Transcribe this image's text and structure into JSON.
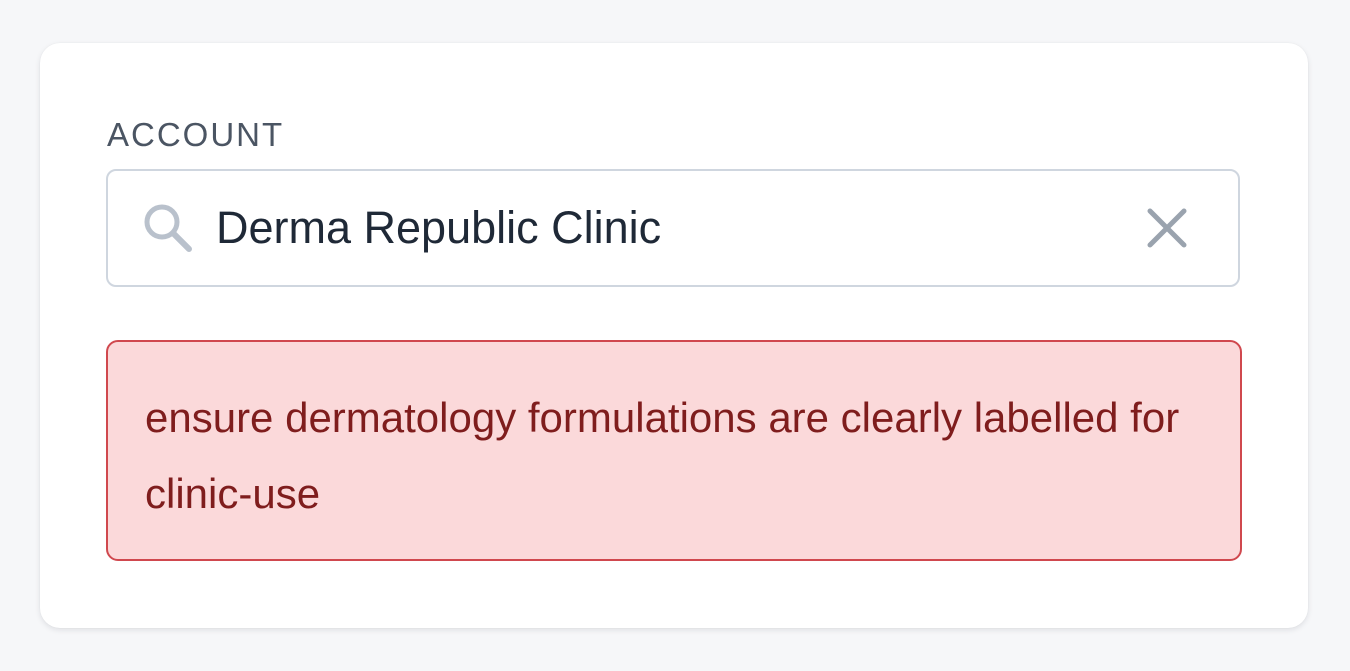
{
  "account_field": {
    "label": "ACCOUNT",
    "value": "Derma Republic Clinic",
    "leading_icon": "search-icon",
    "trailing_icon": "close-icon"
  },
  "alert": {
    "type": "error",
    "message": "ensure dermatology formulations are clearly labelled for clinic-use"
  },
  "colors": {
    "page_background": "#f6f7f9",
    "card_background": "#ffffff",
    "input_border": "#cfd6df",
    "icon_gray": "#b9c1cc",
    "error_background": "#fbd9da",
    "error_border": "#d0484e",
    "error_text": "#7f1d1d"
  }
}
